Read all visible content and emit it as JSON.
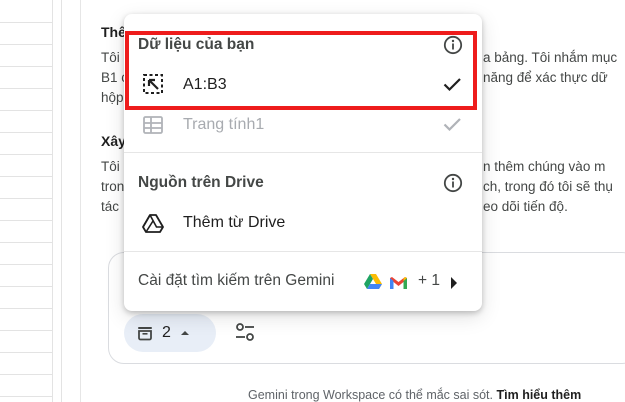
{
  "background": {
    "heading_1": "Thê",
    "para_1_line_1_left": "Tôi",
    "para_1_line_1_right": "a bảng. Tôi nhắm mục",
    "para_1_line_2_left": "B1 c",
    "para_1_line_2_right": "năng để xác thực dữ",
    "para_1_line_3_left": "hộp",
    "heading_2": "Xây",
    "para_2_line_1_left": "Tôi",
    "para_2_line_1_right": "n thêm chúng vào m",
    "para_2_line_2_left": "tron",
    "para_2_line_2_right": "ch, trong đó tôi sẽ thụ",
    "para_2_line_3_left": "tác",
    "para_2_line_3_right": "eo dõi tiến độ."
  },
  "chip": {
    "count": "2"
  },
  "footer": {
    "note": "Gemini trong Workspace có thể mắc sai sót.",
    "link": "Tìm hiểu thêm"
  },
  "menu": {
    "section_1_title": "Dữ liệu của bạn",
    "range_item_label": "A1:B3",
    "sheet_item_label": "Trang tính1",
    "section_2_title": "Nguồn trên Drive",
    "add_from_drive_label": "Thêm từ Drive",
    "settings_label": "Cài đặt tìm kiếm trên Gemini",
    "settings_extra_count": "+ 1"
  },
  "colors": {
    "highlight": "#ee1c1c",
    "chip_bg": "#e8eef7"
  }
}
